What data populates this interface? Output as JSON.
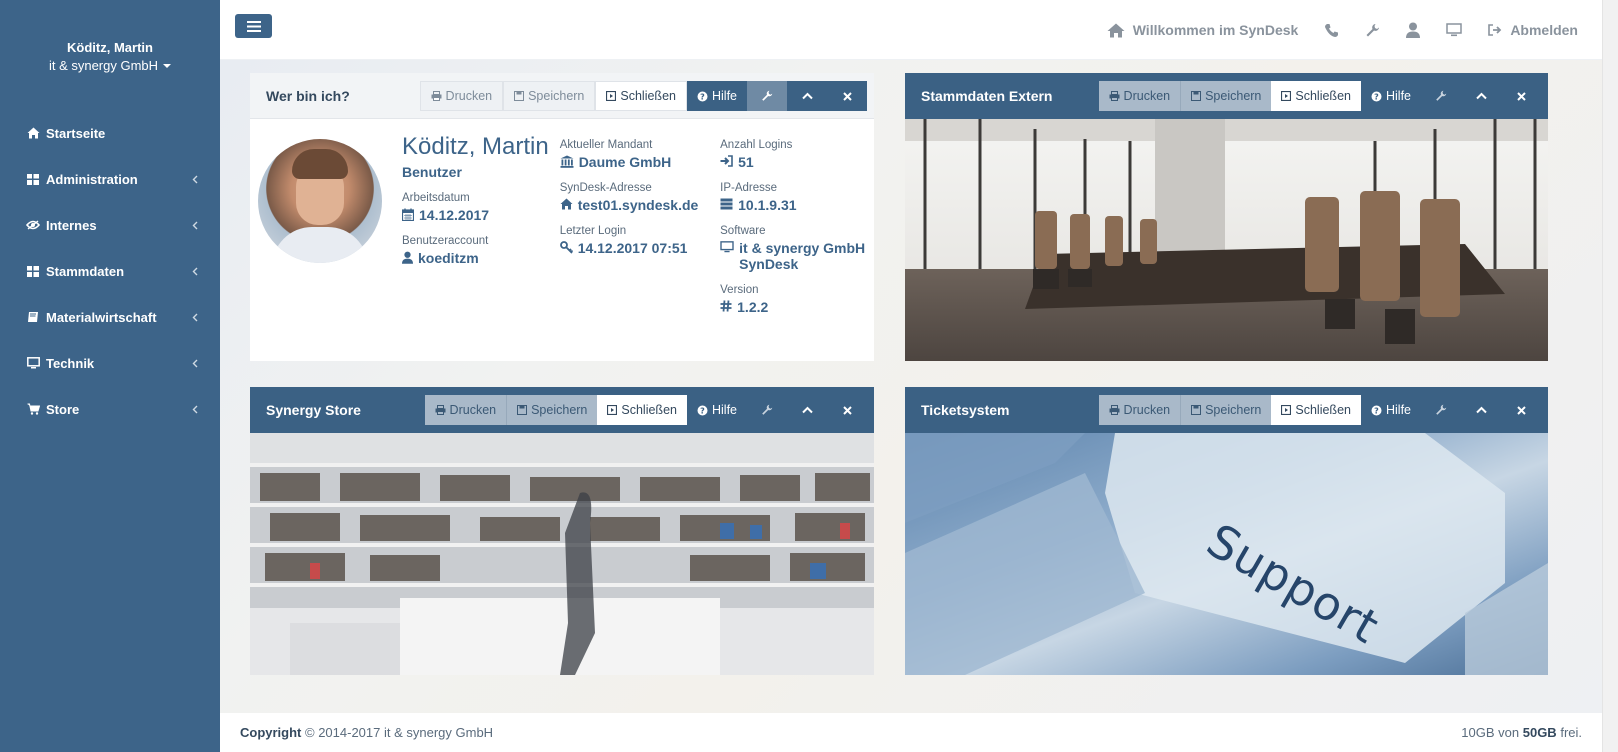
{
  "sidebar": {
    "user_name": "Köditz, Martin",
    "user_company": "it & synergy GmbH",
    "items": [
      {
        "label": "Startseite",
        "icon": "home-icon",
        "has_children": false
      },
      {
        "label": "Administration",
        "icon": "grid-icon",
        "has_children": true
      },
      {
        "label": "Internes",
        "icon": "eye-slash-icon",
        "has_children": true
      },
      {
        "label": "Stammdaten",
        "icon": "grid-icon",
        "has_children": true
      },
      {
        "label": "Materialwirtschaft",
        "icon": "book-icon",
        "has_children": true
      },
      {
        "label": "Technik",
        "icon": "monitor-icon",
        "has_children": true
      },
      {
        "label": "Store",
        "icon": "cart-icon",
        "has_children": true
      }
    ]
  },
  "topbar": {
    "welcome": "Willkommen im SynDesk",
    "logout": "Abmelden"
  },
  "buttons": {
    "print": "Drucken",
    "save": "Speichern",
    "close": "Schließen",
    "help": "Hilfe"
  },
  "panels": {
    "profile": {
      "title": "Wer bin ich?",
      "name": "Köditz, Martin",
      "role": "Benutzer",
      "fields": {
        "work_date_label": "Arbeitsdatum",
        "work_date": "14.12.2017",
        "account_label": "Benutzeraccount",
        "account": "koeditzm",
        "client_label": "Aktueller Mandant",
        "client": "Daume GmbH",
        "address_label": "SynDesk-Adresse",
        "address": "test01.syndesk.de",
        "last_login_label": "Letzter Login",
        "last_login": "14.12.2017 07:51",
        "logins_label": "Anzahl Logins",
        "logins": "51",
        "ip_label": "IP-Adresse",
        "ip": "10.1.9.31",
        "software_label": "Software",
        "software": "it & synergy GmbH SynDesk",
        "version_label": "Version",
        "version": "1.2.2"
      }
    },
    "stammdaten": {
      "title": "Stammdaten Extern"
    },
    "store": {
      "title": "Synergy Store"
    },
    "ticket": {
      "title": "Ticketsystem",
      "image_text": "Support"
    }
  },
  "footer": {
    "copyright_label": "Copyright",
    "copyright_text": "© 2014-2017 it & synergy GmbH",
    "storage_prefix": "10GB von",
    "storage_total": "50GB",
    "storage_suffix": "frei."
  },
  "colors": {
    "sidebar": "#3d6489",
    "panel_header": "#3b6184",
    "accent": "#3d6489"
  }
}
